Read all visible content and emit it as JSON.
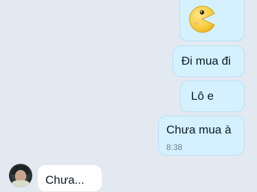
{
  "messages": {
    "m0": {
      "emoji": "pacman-emoji"
    },
    "m1": {
      "text": "Đi mua đi"
    },
    "m2": {
      "text": "Lô e"
    },
    "m3": {
      "text": "Chưa mua à",
      "time": "8:38"
    },
    "m4": {
      "text": "Chưa..."
    }
  },
  "colors": {
    "background": "#e3e9f1",
    "outgoing_bubble": "#d5f1ff",
    "incoming_bubble": "#ffffff",
    "emoji_yellow": "#f8d44c"
  }
}
